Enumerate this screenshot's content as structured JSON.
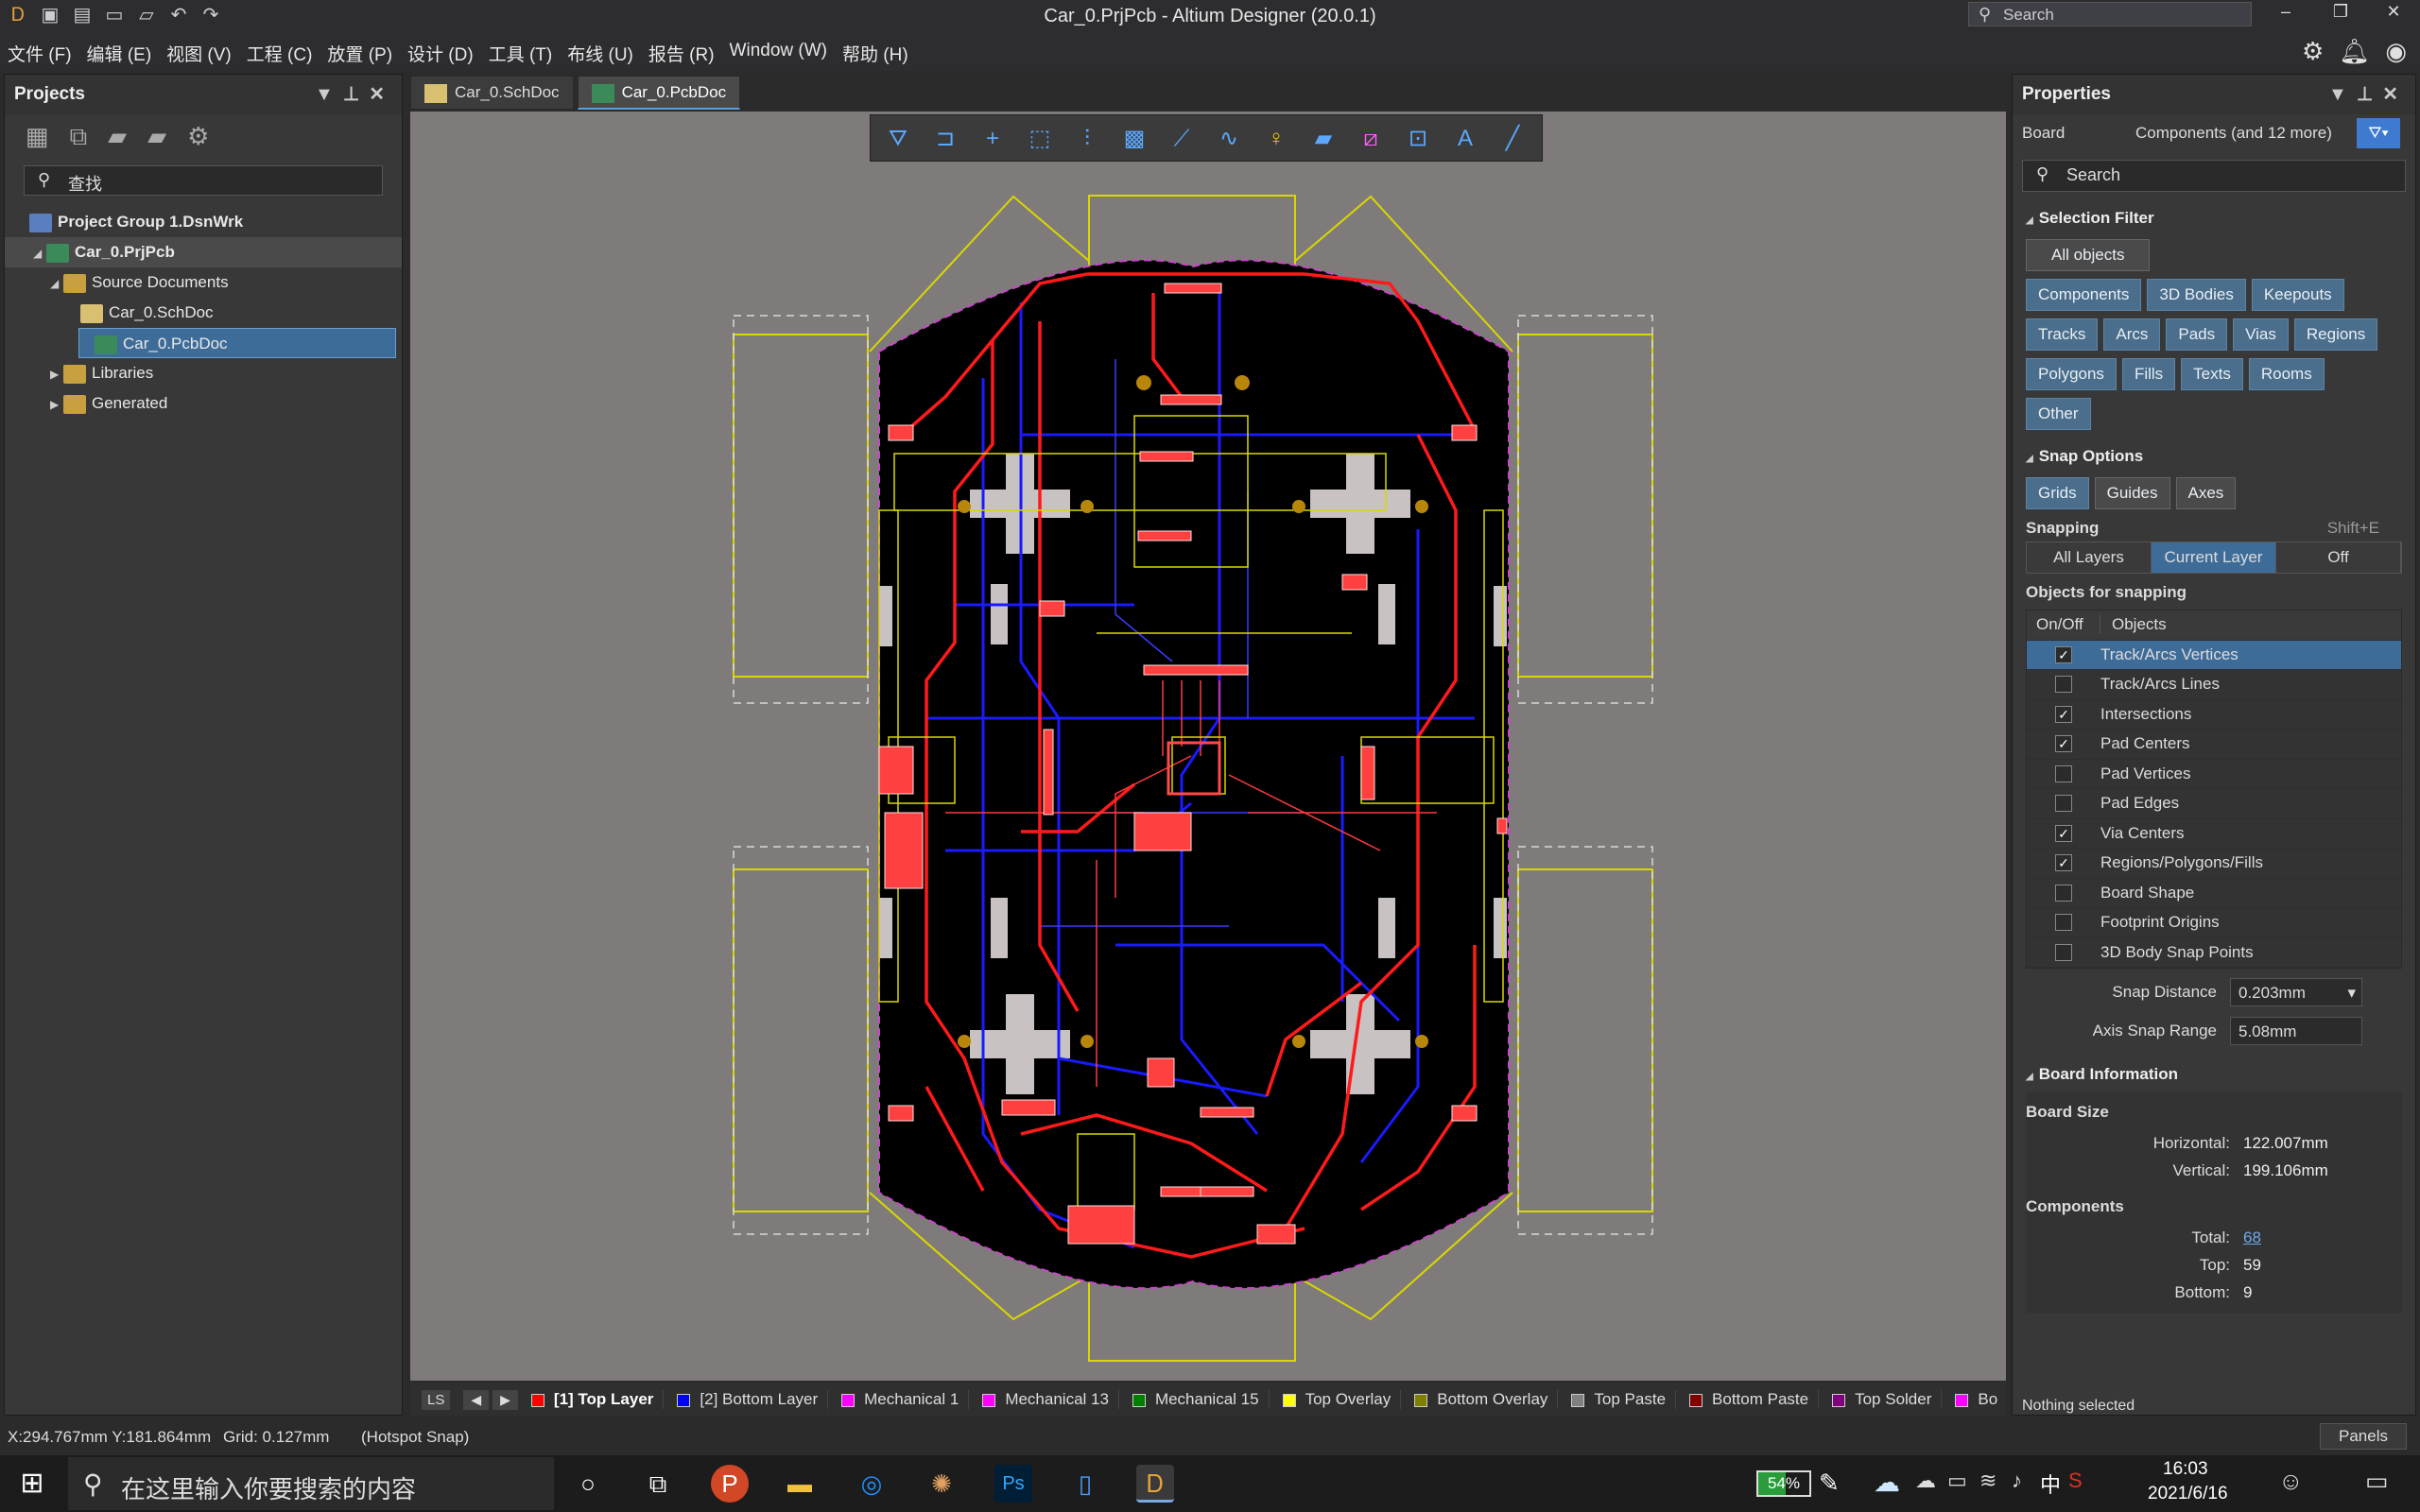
{
  "window": {
    "title": "Car_0.PrjPcb - Altium Designer (20.0.1)",
    "search_placeholder": "Search"
  },
  "menu": [
    "文件 (F)",
    "编辑 (E)",
    "视图 (V)",
    "工程 (C)",
    "放置 (P)",
    "设计 (D)",
    "工具 (T)",
    "布线 (U)",
    "报告 (R)",
    "Window (W)",
    "帮助 (H)"
  ],
  "projects": {
    "title": "Projects",
    "search_placeholder": "查找",
    "tree": [
      {
        "label": "Project Group 1.DsnWrk",
        "level": 0
      },
      {
        "label": "Car_0.PrjPcb",
        "level": 1
      },
      {
        "label": "Source Documents",
        "level": 2
      },
      {
        "label": "Car_0.SchDoc",
        "level": 3
      },
      {
        "label": "Car_0.PcbDoc",
        "level": 3
      },
      {
        "label": "Libraries",
        "level": 2
      },
      {
        "label": "Generated",
        "level": 2
      }
    ]
  },
  "doc_tabs": [
    {
      "label": "Car_0.SchDoc"
    },
    {
      "label": "Car_0.PcbDoc"
    }
  ],
  "layers": [
    {
      "label": "[1] Top Layer",
      "color": "#ff0000"
    },
    {
      "label": "[2] Bottom Layer",
      "color": "#0000ff"
    },
    {
      "label": "Mechanical 1",
      "color": "#ff00ff"
    },
    {
      "label": "Mechanical 13",
      "color": "#ff00ff"
    },
    {
      "label": "Mechanical 15",
      "color": "#008000"
    },
    {
      "label": "Top Overlay",
      "color": "#ffff00"
    },
    {
      "label": "Bottom Overlay",
      "color": "#808000"
    },
    {
      "label": "Top Paste",
      "color": "#808080"
    },
    {
      "label": "Bottom Paste",
      "color": "#800000"
    },
    {
      "label": "Top Solder",
      "color": "#800080"
    },
    {
      "label": "Bo",
      "color": "#ff00ff"
    }
  ],
  "layer_set_label": "LS",
  "status": {
    "coords": "X:294.767mm Y:181.864mm",
    "grid": "Grid: 0.127mm",
    "snap": "(Hotspot Snap)",
    "panels": "Panels"
  },
  "properties": {
    "title": "Properties",
    "board_label": "Board",
    "filter_label": "Components (and 12 more)",
    "search_placeholder": "Search",
    "selection_filter_title": "Selection Filter",
    "all_objects": "All objects",
    "filter_buttons": [
      "Components",
      "3D Bodies",
      "Keepouts",
      "Tracks",
      "Arcs",
      "Pads",
      "Vias",
      "Regions",
      "Polygons",
      "Fills",
      "Texts",
      "Rooms",
      "Other"
    ],
    "snap_options_title": "Snap Options",
    "snap_buttons": [
      "Grids",
      "Guides",
      "Axes"
    ],
    "snapping_label": "Snapping",
    "snapping_shortcut": "Shift+E",
    "snapping_modes": [
      "All Layers",
      "Current Layer",
      "Off"
    ],
    "objects_for_snapping": "Objects for snapping",
    "col_onoff": "On/Off",
    "col_objects": "Objects",
    "snap_objects": [
      {
        "label": "Track/Arcs Vertices",
        "checked": true
      },
      {
        "label": "Track/Arcs Lines",
        "checked": false
      },
      {
        "label": "Intersections",
        "checked": true
      },
      {
        "label": "Pad Centers",
        "checked": true
      },
      {
        "label": "Pad Vertices",
        "checked": false
      },
      {
        "label": "Pad Edges",
        "checked": false
      },
      {
        "label": "Via Centers",
        "checked": true
      },
      {
        "label": "Regions/Polygons/Fills",
        "checked": true
      },
      {
        "label": "Board Shape",
        "checked": false
      },
      {
        "label": "Footprint Origins",
        "checked": false
      },
      {
        "label": "3D Body Snap Points",
        "checked": false
      }
    ],
    "snap_distance_label": "Snap Distance",
    "snap_distance": "0.203mm",
    "axis_snap_label": "Axis Snap Range",
    "axis_snap": "5.08mm",
    "board_info_title": "Board Information",
    "board_size_title": "Board Size",
    "horizontal_label": "Horizontal:",
    "horizontal": "122.007mm",
    "vertical_label": "Vertical:",
    "vertical": "199.106mm",
    "components_title": "Components",
    "total_label": "Total:",
    "total": "68",
    "top_label": "Top:",
    "top": "59",
    "bottom_label": "Bottom:",
    "bottom": "9",
    "nothing_selected": "Nothing selected"
  },
  "taskbar": {
    "search_placeholder": "在这里输入你要搜索的内容",
    "battery": "54%",
    "ime": "中",
    "time": "16:03",
    "date": "2021/6/16"
  }
}
